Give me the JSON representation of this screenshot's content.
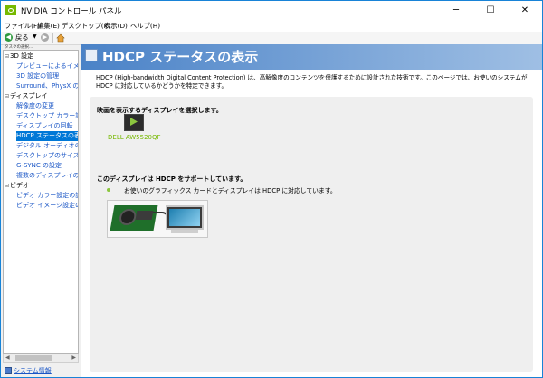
{
  "window": {
    "title": "NVIDIA コントロール パネル"
  },
  "menu": [
    "ファイル(F)",
    "編集(E)",
    "デスクトップ(K)",
    "表示(D)",
    "ヘルプ(H)"
  ],
  "toolbar": {
    "back_label": "戻る"
  },
  "task_label": "タスクの選択...",
  "sidebar": {
    "groups": [
      {
        "label": "3D 設定",
        "items": [
          "プレビューによるイメージ",
          "3D 設定の管理",
          "Surround、PhysX の設定"
        ]
      },
      {
        "label": "ディスプレイ",
        "items": [
          "解像度の変更",
          "デスクトップ カラー設定",
          "ディスプレイの回転",
          "HDCP ステータスの表示",
          "デジタル オーディオの設定",
          "デスクトップのサイズと位置",
          "G-SYNC の設定",
          "複数のディスプレイの設定"
        ]
      },
      {
        "label": "ビデオ",
        "items": [
          "ビデオ カラー設定の調整",
          "ビデオ イメージ設定の調整"
        ]
      }
    ],
    "selected": "HDCP ステータスの表示"
  },
  "system_info": "システム情報",
  "page": {
    "title": "HDCP ステータスの表示",
    "description": "HDCP (High-bandwidth Digital Content Protection) は、高解像度のコンテンツを保護するために設計された技術です。このページでは、お使いのシステムが HDCP に対応しているかどうかを特定できます。",
    "select_display_label": "映画を表示するディスプレイを選択します。",
    "display_name": "DELL AW5520QF",
    "support_heading": "このディスプレイは HDCP をサポートしています。",
    "support_detail": "お使いのグラフィックス カードとディスプレイは HDCP に対応しています。"
  },
  "colors": {
    "accent": "#0078d7",
    "header_start": "#4a82c7",
    "header_end": "#9fbfe4",
    "nvidia_green": "#76b900",
    "link": "#1a56c6"
  }
}
